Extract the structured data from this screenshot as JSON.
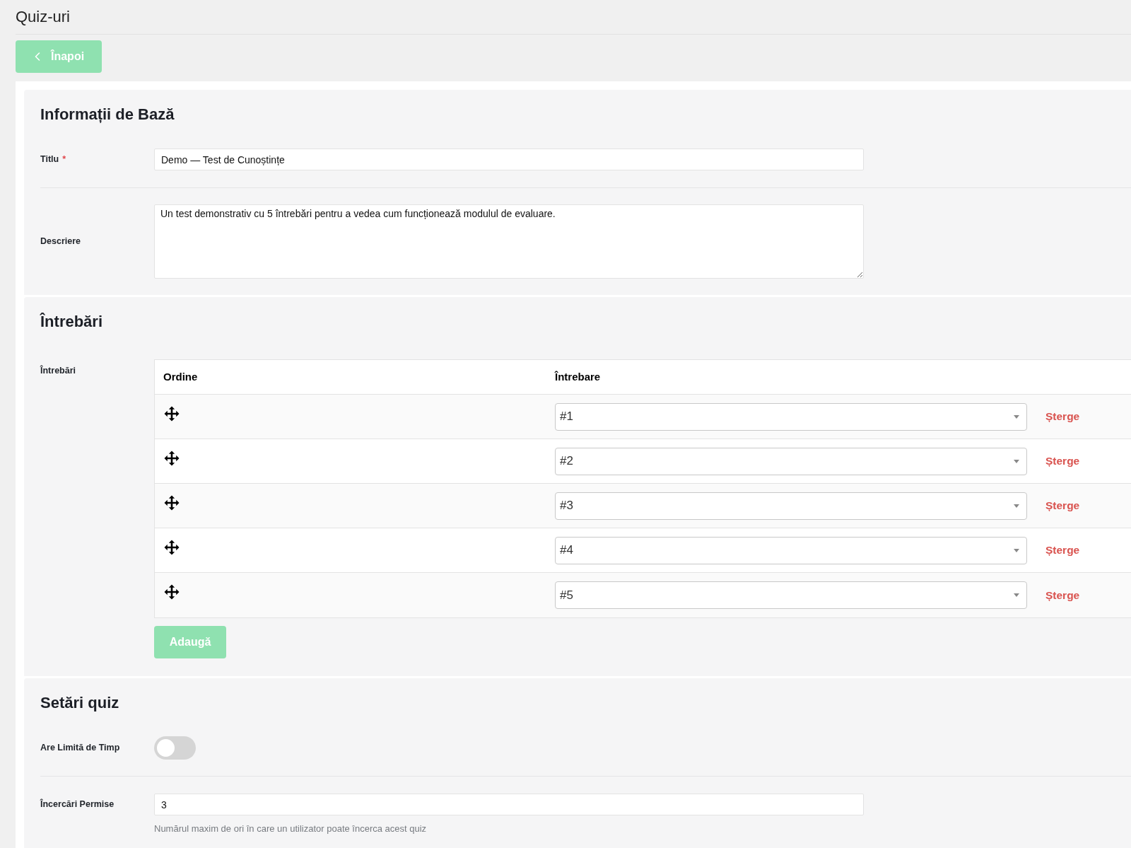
{
  "page_title": "Quiz-uri",
  "back_button": {
    "label": "Înapoi"
  },
  "sections": [
    {
      "heading": "Informații de Bază",
      "fields": [
        {
          "kind": "text",
          "label": "Titlu",
          "required_mark": "*",
          "value": "Demo — Test de Cunoștințe"
        },
        {
          "kind": "textarea",
          "label": "Descriere",
          "value": "Un test demonstrativ cu 5 întrebări pentru a vedea cum funcționează modulul de evaluare."
        }
      ]
    },
    {
      "heading": "Întrebări",
      "fields": [
        {
          "kind": "repeater",
          "label": "Întrebări",
          "columns": [
            "Ordine",
            "Întrebare"
          ],
          "rows": [
            {
              "question": "#1",
              "delete": "Șterge"
            },
            {
              "question": "#2",
              "delete": "Șterge"
            },
            {
              "question": "#3",
              "delete": "Șterge"
            },
            {
              "question": "#4",
              "delete": "Șterge"
            },
            {
              "question": "#5",
              "delete": "Șterge"
            }
          ],
          "add_button": "Adaugă"
        }
      ]
    },
    {
      "heading": "Setări quiz",
      "fields": [
        {
          "kind": "toggle",
          "label": "Are Limită de Timp",
          "on": false
        },
        {
          "kind": "number",
          "label": "Încercări Permise",
          "value": "3",
          "hint": "Numărul maxim de ori în care un utilizator poate încerca acest quiz"
        }
      ]
    }
  ]
}
